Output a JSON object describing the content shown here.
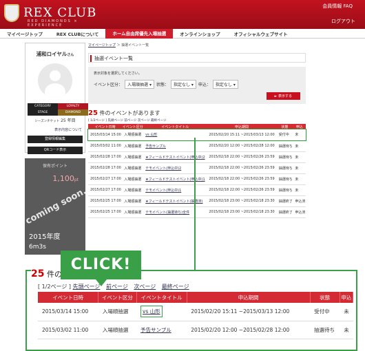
{
  "header": {
    "logo": "REX CLUB",
    "sub": "RED DIAMONDS × EXPERIENCE",
    "util": "会員情報 FAQ",
    "logout": "ログアウト"
  },
  "nav": [
    "マイページトップ",
    "REX CLUBについて",
    "ホーム自由席優先入場抽選",
    "オンラインショップ",
    "オフィシャルウェブサイト"
  ],
  "profile": {
    "name": "浦和ロイヤル",
    "suffix": "さん",
    "category_label": "CATEGORY",
    "category": "LOYALTY",
    "stage_label": "STAGE",
    "stage": "DIAMOND",
    "season_label": "シーズンチケット",
    "season_years": "25 年目",
    "history_link": "表示内容について",
    "btn_register": "登録情報編集",
    "btn_qr": "QRコード表示"
  },
  "points": {
    "label": "保有ポイント",
    "value": "1,100",
    "unit": "pt",
    "coming": "coming soon...",
    "year": "2015年度",
    "stay": "6m3s"
  },
  "breadcrumb": {
    "top": "マイページトップ",
    "current": "抽選イベント一覧"
  },
  "page_title": "抽選イベント一覧",
  "search": {
    "note": "表示対象を選択してください。",
    "event_label": "イベント区分：",
    "event_value": "入場順抽選",
    "status_label": "状態：",
    "status_value": "指定なし",
    "apply_label": "申込：",
    "apply_value": "指定なし",
    "show_button": "表示する"
  },
  "count": {
    "num": "25",
    "text": "件のイベントがあります"
  },
  "pager": {
    "pos": "[ 1/2ページ ]",
    "first": "先頭ページ",
    "prev": "前ページ",
    "next": "次ページ",
    "last": "最終ページ"
  },
  "columns": [
    "イベント日時",
    "イベント区分",
    "イベントタイトル",
    "申込期間",
    "状態",
    "申込"
  ],
  "rows": [
    {
      "date": "2015/03/14 15:00",
      "type": "入場順抽選",
      "title": "vs 山形",
      "period": "2015/02/20 15:11 ~2015/03/13 12:00",
      "status": "受付中",
      "apply": "未"
    },
    {
      "date": "2015/03/02 11:00",
      "type": "入場順抽選",
      "title": "予告サンプル",
      "period": "2015/02/20 12:00 ~2015/02/28 12:00",
      "status": "抽選待ち",
      "apply": "未"
    },
    {
      "date": "2015/02/28 17:00",
      "type": "入場順抽選",
      "title": "★フィールドテストイベント(申込中)2",
      "period": "2015/02/18 22:00 ~2015/02/26 23:59",
      "status": "抽選待ち",
      "apply": "未"
    },
    {
      "date": "2015/02/28 17:00",
      "type": "入場順抽選",
      "title": "テモイベント(申込中)2",
      "period": "2015/02/18 22:00 ~2015/02/26 23:59",
      "status": "抽選待ち",
      "apply": "未"
    },
    {
      "date": "2015/02/27 17:00",
      "type": "入場順抽選",
      "title": "★フィールドテストイベント(申込中)1",
      "period": "2015/02/18 22:00 ~2015/02/26 23:59",
      "status": "抽選待ち",
      "apply": "未"
    },
    {
      "date": "2015/02/27 17:00",
      "type": "入場順抽選",
      "title": "テモイベント(申込中)1",
      "period": "2015/02/18 22:00 ~2015/02/26 23:59",
      "status": "抽選待ち",
      "apply": "未"
    },
    {
      "date": "2015/02/25 17:00",
      "type": "入場順抽選",
      "title": "★フィールドテストイベント(抽選済)",
      "period": "2015/02/18 23:00 ~2015/02/18 23:30",
      "status": "抽選終了",
      "apply": "申込済"
    },
    {
      "date": "2015/02/25 17:00",
      "type": "入場順抽選",
      "title": "テモイベント(抽選待ち)全件",
      "period": "2015/02/18 23:00 ~2015/02/18 23:30",
      "status": "抽選終了",
      "apply": "申込済"
    }
  ],
  "callout": "CLICK!"
}
